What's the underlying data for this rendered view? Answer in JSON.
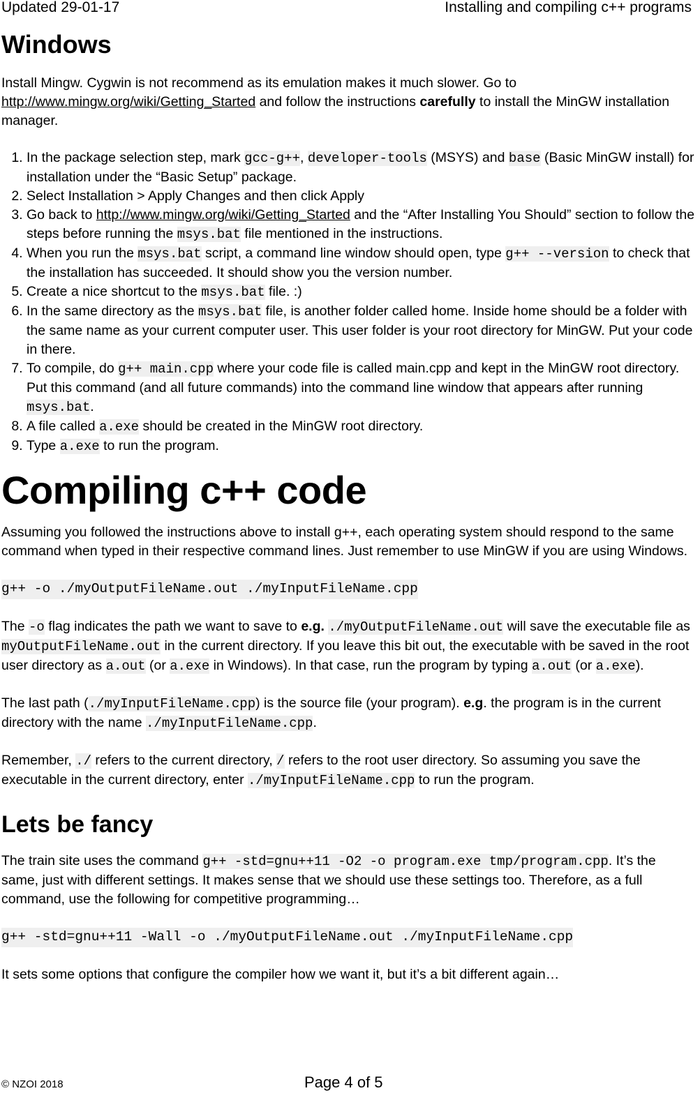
{
  "header": {
    "updated": "Updated 29-01-17",
    "title": "Installing and compiling c++ programs"
  },
  "windows": {
    "heading": "Windows",
    "intro": {
      "t1": "Install Mingw. Cygwin is not recommend as its emulation makes it much slower. Go to ",
      "link": "http://www.mingw.org/wiki/Getting_Started",
      "t2": " and follow the instructions ",
      "bold": "carefully",
      "t3": " to install the MinGW installation manager."
    },
    "steps": [
      {
        "t1": "In the package selection step, mark ",
        "c1": "gcc-g++",
        "t2": ", ",
        "c2": "developer-tools",
        "t3": " (MSYS) and ",
        "c3": "base",
        "t4": " (Basic MinGW install) for installation under the “Basic Setup” package."
      },
      {
        "t1": "Select Installation > Apply Changes and then click Apply"
      },
      {
        "t1": "Go back to ",
        "link": "http://www.mingw.org/wiki/Getting_Started",
        "t2": " and the “After Installing You Should” section to follow the steps before running the ",
        "c1": "msys.bat",
        "t3": " file mentioned in the instructions."
      },
      {
        "t1": "When you run the ",
        "c1": "msys.bat",
        "t2": " script, a command line window should open, type ",
        "c2": "g++ --version",
        "t3": " to check that the installation has succeeded. It should show you the version number."
      },
      {
        "t1": "Create a nice shortcut to the ",
        "c1": "msys.bat",
        "t2": " file. :)"
      },
      {
        "t1": "In the same directory as the ",
        "c1": "msys.bat",
        "t2": " file, is another folder called home. Inside home should be a folder with the same name as your current computer user. This user folder is your root directory for MinGW. Put your code in there."
      },
      {
        "t1": "To compile, do ",
        "c1": "g++ main.cpp",
        "t2": " where your code file is called main.cpp and kept in the MinGW root directory. Put this command (and all future commands) into the command line window that appears after running ",
        "c2": "msys.bat",
        "t3": "."
      },
      {
        "t1": "A file called ",
        "c1": "a.exe",
        "t2": " should be created in the MinGW root directory."
      },
      {
        "t1": "Type ",
        "c1": "a.exe",
        "t2": " to run the program."
      }
    ]
  },
  "compiling": {
    "heading": "Compiling c++ code",
    "intro": "Assuming you followed the instructions above to install g++, each operating system should respond to the same command when typed in their respective command lines. Just remember to use MinGW if you are using Windows.",
    "command": "g++ -o ./myOutputFileName.out ./myInputFileName.cpp",
    "p1": {
      "t1": "The ",
      "c1": "-o",
      "t2": " flag indicates the path we want to save to ",
      "b1": "e.g.",
      "t3": " ",
      "c2": "./myOutputFileName.out",
      "t4": " will save the executable file as ",
      "c3": "myOutputFileName.out",
      "t5": " in the current directory. If you leave this bit out, the executable with be saved in the root user directory as ",
      "c4": "a.out",
      "t6": " (or ",
      "c5": "a.exe",
      "t7": " in Windows). In that case, run the program by typing ",
      "c6": "a.out",
      "t8": " (or ",
      "c7": "a.exe",
      "t9": ")."
    },
    "p2": {
      "t1": "The last path (",
      "c1": "./myInputFileName.cpp",
      "t2": ") is the source file (your program). ",
      "b1": "e.g",
      "t3": ". the program is in the current directory with the name ",
      "c2": "./myInputFileName.cpp",
      "t4": "."
    },
    "p3": {
      "t1": "Remember, ",
      "c1": "./",
      "t2": " refers to the current directory, ",
      "c2": "/",
      "t3": " refers to the root user directory. So assuming you save the executable in the current directory, enter ",
      "c3": "./myInputFileName.cpp",
      "t4": " to run the program."
    }
  },
  "fancy": {
    "heading": "Lets be fancy",
    "p1": {
      "t1": "The train site uses the command ",
      "c1": "g++ -std=gnu++11 -O2 -o program.exe tmp/program.cpp",
      "t2": ". It’s the same, just with different settings. It makes sense that we should use these settings too. Therefore, as a full command, use the following for competitive programming…"
    },
    "command": "g++ -std=gnu++11 -Wall -o ./myOutputFileName.out ./myInputFileName.cpp",
    "p2": "It sets some options that configure the compiler how we want it, but it’s a bit different again…"
  },
  "footer": {
    "copyright": "© NZOI 2018",
    "page": "Page 4 of 5"
  }
}
